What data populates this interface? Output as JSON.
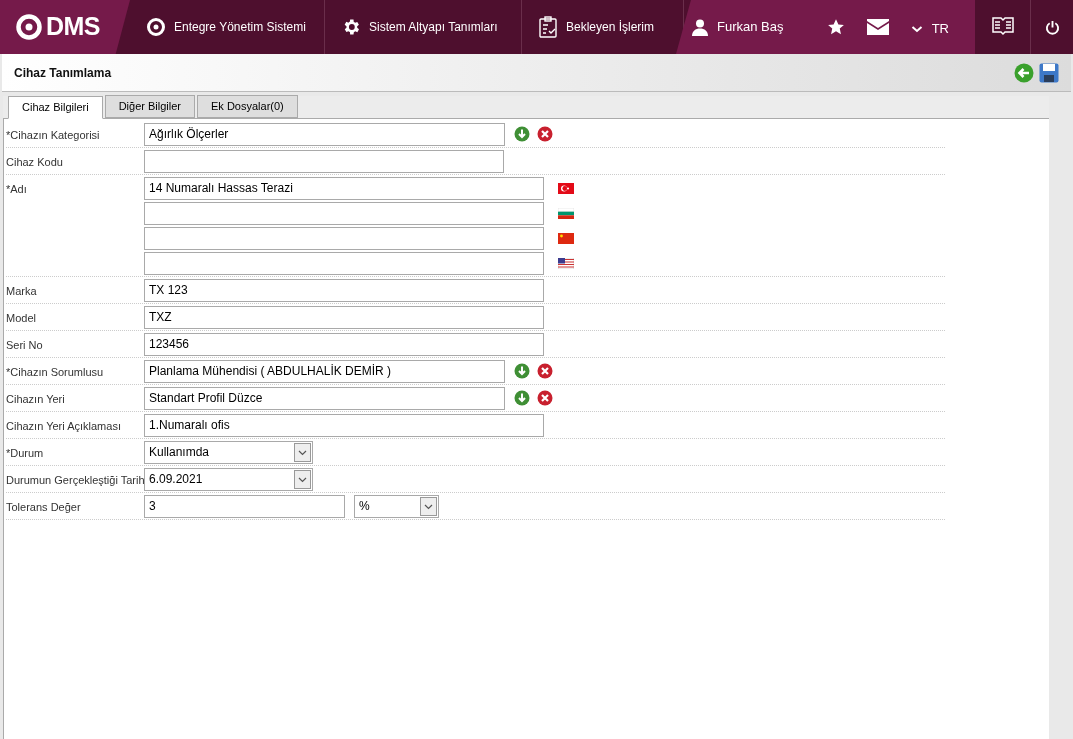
{
  "header": {
    "logo": "DMS",
    "nav": [
      {
        "kind": "system",
        "label": "Entegre Yönetim Sistemi"
      },
      {
        "kind": "settings",
        "label": "Sistem Altyapı Tanımları"
      },
      {
        "kind": "tasks",
        "label": "Bekleyen İşlerim"
      }
    ],
    "user": "Furkan Baş",
    "language": "TR"
  },
  "page": {
    "title": "Cihaz Tanımlama"
  },
  "tabs": [
    {
      "label": "Cihaz Bilgileri",
      "selected": true
    },
    {
      "label": "Diğer Bilgiler",
      "selected": false
    },
    {
      "label": "Ek Dosyalar(0)",
      "selected": false
    }
  ],
  "rows": [
    {
      "kind": "picker",
      "label": "*Cihazın Kategorisi",
      "value": "Ağırlık Ölçerler"
    },
    {
      "kind": "short_text",
      "label": "Cihaz Kodu"
    },
    {
      "kind": "multilang",
      "label": "*Adı",
      "entries": [
        {
          "kind": "turkish",
          "value": "14 Numaralı Hassas Terazi"
        },
        {
          "kind": "bulgarian"
        },
        {
          "kind": "chinese"
        },
        {
          "kind": "english"
        }
      ]
    },
    {
      "kind": "text",
      "label": "Marka",
      "value": "TX 123"
    },
    {
      "kind": "text",
      "label": "Model",
      "value": "TXZ"
    },
    {
      "kind": "text",
      "label": "Seri No",
      "value": "123456"
    },
    {
      "kind": "picker",
      "label": "*Cihazın Sorumlusu",
      "value": "Planlama Mühendisi ( ABDULHALİK DEMİR )"
    },
    {
      "kind": "picker",
      "label": "Cihazın Yeri",
      "value": "Standart Profil Düzce"
    },
    {
      "kind": "text",
      "label": "Cihazın Yeri Açıklaması",
      "value": "1.Numaralı ofis"
    },
    {
      "kind": "select",
      "label": "*Durum",
      "value": "Kullanımda"
    },
    {
      "kind": "select",
      "label": "Durumun Gerçekleştiği Tarih",
      "value": "6.09.2021"
    },
    {
      "kind": "unit",
      "label": "Tolerans Değer",
      "value": "3",
      "unit": "%"
    }
  ]
}
